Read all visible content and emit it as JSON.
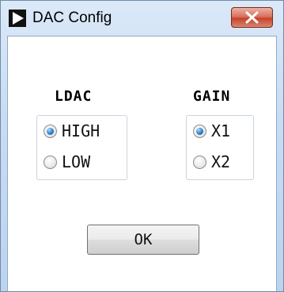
{
  "window": {
    "title": "DAC Config",
    "app_icon": "play-triangle-icon",
    "close_icon": "close-x-icon"
  },
  "ldac": {
    "label": "LDAC",
    "options": [
      {
        "label": "HIGH",
        "checked": true
      },
      {
        "label": "LOW",
        "checked": false
      }
    ]
  },
  "gain": {
    "label": "GAIN",
    "options": [
      {
        "label": "X1",
        "checked": true
      },
      {
        "label": "X2",
        "checked": false
      }
    ]
  },
  "ok_button": {
    "label": "OK"
  },
  "colors": {
    "title_bar": "#c8dcf3",
    "close_button": "#c6432a",
    "radio_selected": "#2f7fc8"
  }
}
